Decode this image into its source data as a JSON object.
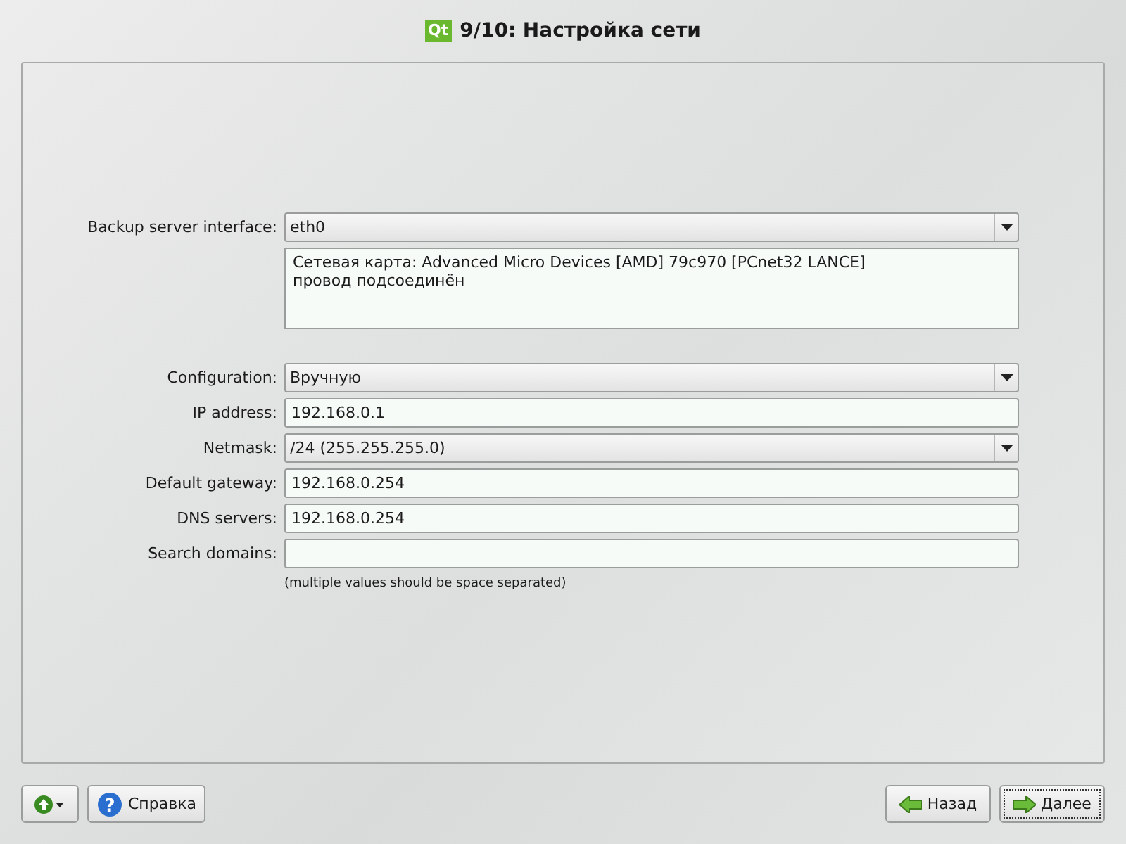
{
  "window": {
    "logo": "Qt",
    "title": "9/10: Настройка сети"
  },
  "interface": {
    "label": "Backup server interface:",
    "value": "eth0",
    "description": [
      "Сетевая карта: Advanced Micro Devices [AMD] 79c970 [PCnet32 LANCE]",
      "провод подсоединён"
    ]
  },
  "fields": [
    {
      "kind": "dropdown",
      "label": "Configuration:",
      "value": "Вручную"
    },
    {
      "kind": "text",
      "label": "IP address:",
      "value": "192.168.0.1"
    },
    {
      "kind": "dropdown",
      "label": "Netmask:",
      "value": "/24 (255.255.255.0)"
    },
    {
      "kind": "text",
      "label": "Default gateway:",
      "value": "192.168.0.254"
    },
    {
      "kind": "text",
      "label": "DNS servers:",
      "value": "192.168.0.254"
    },
    {
      "kind": "text",
      "label": "Search domains:"
    }
  ],
  "hint": "(multiple values should be space separated)",
  "buttons": {
    "help_icon": "?",
    "help": "Справка",
    "back": "Назад",
    "next": "Далее"
  }
}
